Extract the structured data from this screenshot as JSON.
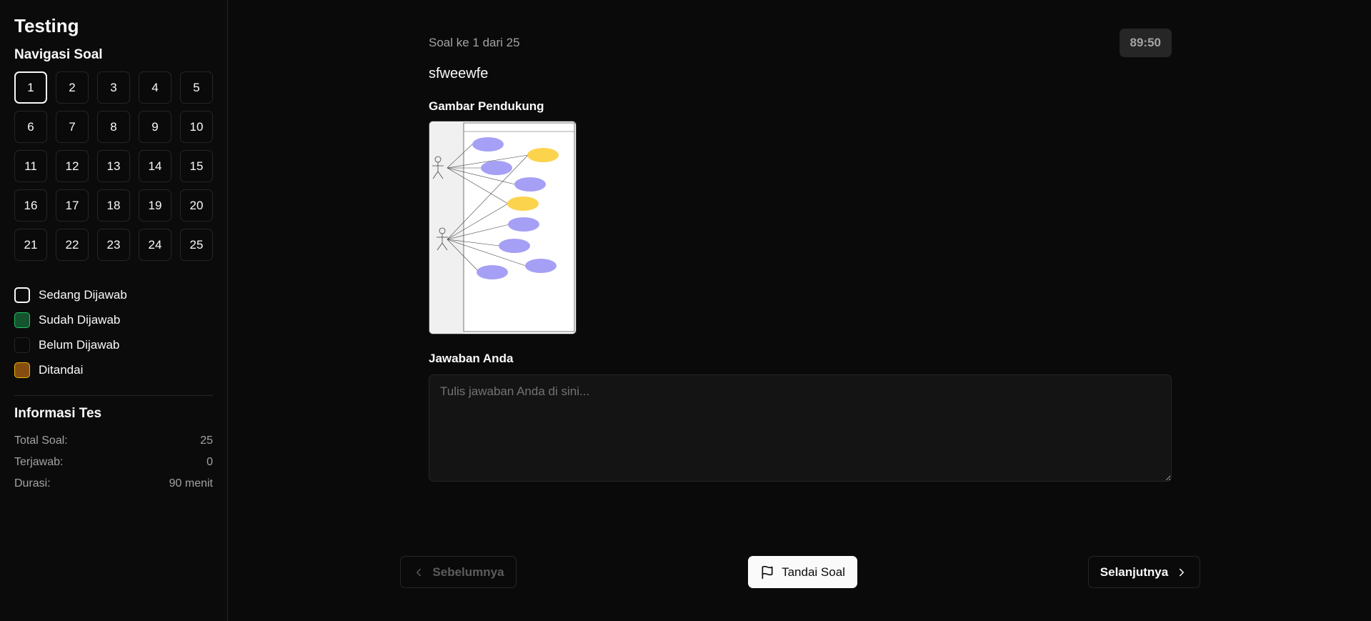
{
  "app": {
    "title": "Testing"
  },
  "navigation": {
    "title": "Navigasi Soal",
    "questions": [
      "1",
      "2",
      "3",
      "4",
      "5",
      "6",
      "7",
      "8",
      "9",
      "10",
      "11",
      "12",
      "13",
      "14",
      "15",
      "16",
      "17",
      "18",
      "19",
      "20",
      "21",
      "22",
      "23",
      "24",
      "25"
    ],
    "current": "1"
  },
  "legend": {
    "current": "Sedang Dijawab",
    "answered": "Sudah Dijawab",
    "unanswered": "Belum Dijawab",
    "flagged": "Ditandai"
  },
  "info": {
    "title": "Informasi Tes",
    "total_label": "Total Soal:",
    "total_value": "25",
    "answered_label": "Terjawab:",
    "answered_value": "0",
    "duration_label": "Durasi:",
    "duration_value": "90 menit"
  },
  "question": {
    "counter": "Soal ke 1 dari 25",
    "timer": "89:50",
    "text": "sfweewfe",
    "image_label": "Gambar Pendukung",
    "answer_label": "Jawaban Anda",
    "answer_placeholder": "Tulis jawaban Anda di sini...",
    "answer_value": ""
  },
  "footer": {
    "prev_label": "Sebelumnya",
    "flag_label": "Tandai Soal",
    "next_label": "Selanjutnya"
  },
  "colors": {
    "background": "#0a0a0a",
    "border": "#262626",
    "answered": "#14532d",
    "flagged": "#854d0e",
    "usecase_purple": "#a5a0f5",
    "usecase_yellow": "#fcd34d"
  },
  "icons": {
    "prev": "chevron-left-icon",
    "flag": "flag-icon",
    "next": "chevron-right-icon"
  }
}
